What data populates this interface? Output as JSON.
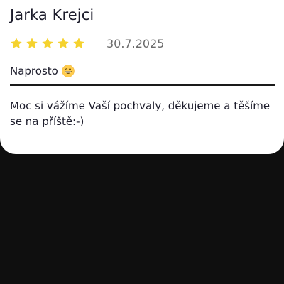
{
  "review": {
    "author": "Jarka Krejci",
    "rating": 5,
    "rating_max": 5,
    "date": "30.7.2025",
    "text": "Naprosto",
    "emoji_icon": "grinning-face-emoji-icon",
    "star_color": "#F5D22E"
  },
  "reply": {
    "text": "Moc si vážíme Vaší pochvaly, děkujeme a těšíme se na příště:-)"
  }
}
